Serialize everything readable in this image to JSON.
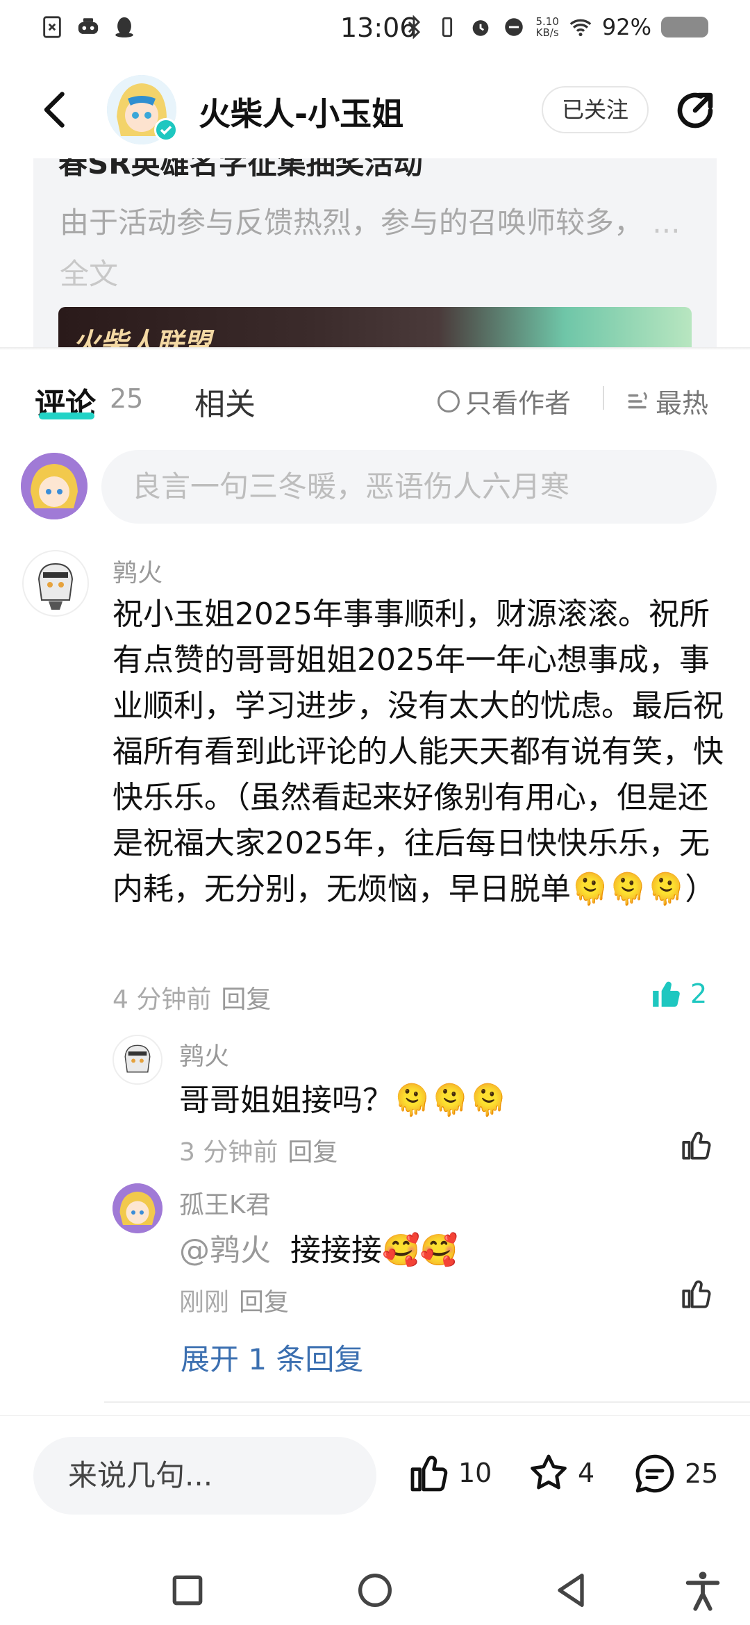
{
  "status_bar": {
    "time": "13:06",
    "speed_value": "5.10",
    "speed_unit": "KB/s",
    "battery": "92%"
  },
  "header": {
    "author_name": "火柴人-小玉姐",
    "follow_label": "已关注"
  },
  "post": {
    "title": "春SR英雄名字征集抽奖活动",
    "excerpt": "由于活动参与反馈热烈，参与的召唤师较多，",
    "more": " ... 全文",
    "image_text": "火柴人联盟"
  },
  "tabs": {
    "comments": "评论",
    "comments_count": "25",
    "related": "相关",
    "only_author": "只看作者",
    "sort_hot": "最热"
  },
  "comment_input": {
    "placeholder": "良言一句三冬暖，恶语伤人六月寒"
  },
  "comments": [
    {
      "user": "鹑火",
      "text": "祝小玉姐2025年事事顺利，财源滚滚。祝所有点赞的哥哥姐姐2025年一年心想事成，事业顺利，学习进步，没有太大的忧虑。最后祝福所有看到此评论的人能天天都有说有笑，快快乐乐。（虽然看起来好像别有用心，但是还是祝福大家2025年，往后每日快快乐乐，无内耗，无分别，无烦恼，早日脱单🫠🫠🫠）",
      "time": "4 分钟前",
      "reply": "回复",
      "likes": "2"
    }
  ],
  "replies": [
    {
      "user": "鹑火",
      "text": "哥哥姐姐接吗？🫠🫠🫠",
      "time": "3 分钟前",
      "reply": "回复"
    },
    {
      "user": "孤王K君",
      "mention": "@鹑火",
      "text": "接接接🥰🥰",
      "time": "刚刚",
      "reply": "回复"
    }
  ],
  "expand_label": "展开 1 条回复",
  "bottom_bar": {
    "input_placeholder": "来说几句...",
    "likes": "10",
    "stars": "4",
    "comments": "25"
  },
  "colors": {
    "accent": "#22d3c6",
    "link": "#3b6fb0",
    "like_active": "#1ec7c0"
  }
}
